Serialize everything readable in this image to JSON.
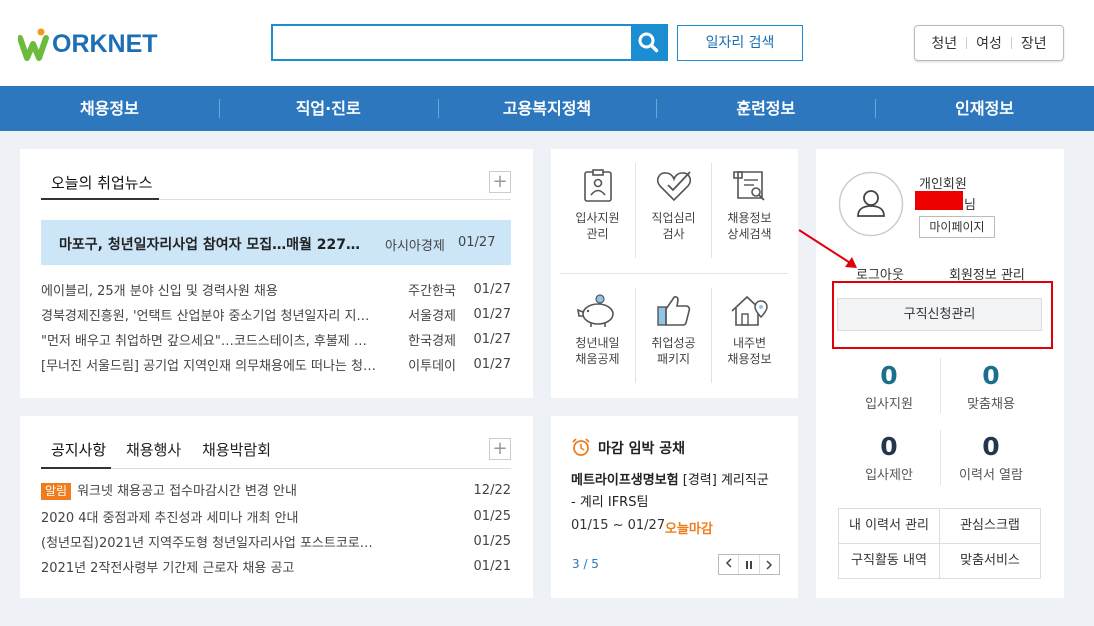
{
  "header": {
    "logo_text": "ORKNET",
    "search_placeholder": "",
    "job_search_label": "일자리 검색",
    "group_links": [
      "청년",
      "여성",
      "장년"
    ]
  },
  "nav": [
    "채용정보",
    "직업·진로",
    "고용복지정책",
    "훈련정보",
    "인재정보"
  ],
  "news": {
    "tab": "오늘의 취업뉴스",
    "headline": {
      "title": "마포구, 청년일자리사업 참여자 모집…매월 227…",
      "source": "아시아경제",
      "date": "01/27"
    },
    "items": [
      {
        "title": "에이블리, 25개 분야 신입 및 경력사원 채용",
        "source": "주간한국",
        "date": "01/27"
      },
      {
        "title": "경북경제진흥원, '언택트 산업분야 중소기업 청년일자리 지…",
        "source": "서울경제",
        "date": "01/27"
      },
      {
        "title": "\"먼저 배우고 취업하면 갚으세요\"…코드스테이츠, 후불제 코…",
        "source": "한국경제",
        "date": "01/27"
      },
      {
        "title": "[무너진 서울드림] 공기업 지역인재 의무채용에도 떠나는 청…",
        "source": "이투데이",
        "date": "01/27"
      }
    ]
  },
  "services": [
    {
      "label1": "입사지원",
      "label2": "관리",
      "icon": "clipboard-icon"
    },
    {
      "label1": "직업심리",
      "label2": "검사",
      "icon": "heart-check-icon"
    },
    {
      "label1": "채용정보",
      "label2": "상세검색",
      "icon": "scroll-search-icon"
    },
    {
      "label1": "청년내일",
      "label2": "채움공제",
      "icon": "piggy-bank-icon"
    },
    {
      "label1": "취업성공",
      "label2": "패키지",
      "icon": "thumbs-up-icon"
    },
    {
      "label1": "내주변",
      "label2": "채용정보",
      "icon": "house-pin-icon"
    }
  ],
  "notice": {
    "tabs": [
      "공지사항",
      "채용행사",
      "채용박람회"
    ],
    "badge": "알림",
    "items": [
      {
        "title": "워크넷 채용공고 접수마감시간 변경 안내",
        "date": "12/22"
      },
      {
        "title": "2020 4대 중점과제 추진성과 세미나 개최 안내",
        "date": "01/25"
      },
      {
        "title": "(청년모집)2021년 지역주도형 청년일자리사업 포스트코로…",
        "date": "01/25"
      },
      {
        "title": "2021년 2작전사령부 기간제 근로자 채용 공고",
        "date": "01/21"
      }
    ]
  },
  "deadline": {
    "title": "마감 임박 공채",
    "company": "메트라이프생명보험",
    "position": " [경력] 계리직군",
    "position2": "- 계리 IFRS팀",
    "period": "01/15 ~ 01/27",
    "status": "오늘마감",
    "pager": "3 / 5"
  },
  "member": {
    "type": "개인회원",
    "suffix": "님",
    "mypage": "마이페이지",
    "logout": "로그아웃",
    "info": "회원정보 관리",
    "apply_manage": "구직신청관리",
    "stats": [
      {
        "num": "0",
        "label": "입사지원"
      },
      {
        "num": "0",
        "label": "맞춤채용"
      },
      {
        "num": "0",
        "label": "입사제안"
      },
      {
        "num": "0",
        "label": "이력서 열람"
      }
    ],
    "links": [
      "내 이력서 관리",
      "관심스크랩",
      "구직활동 내역",
      "맞춤서비스"
    ]
  },
  "colors": {
    "brand": "#2c77be",
    "accent": "#f07d1d",
    "annotation": "#e0000a",
    "stat": "#1b6e8c"
  }
}
